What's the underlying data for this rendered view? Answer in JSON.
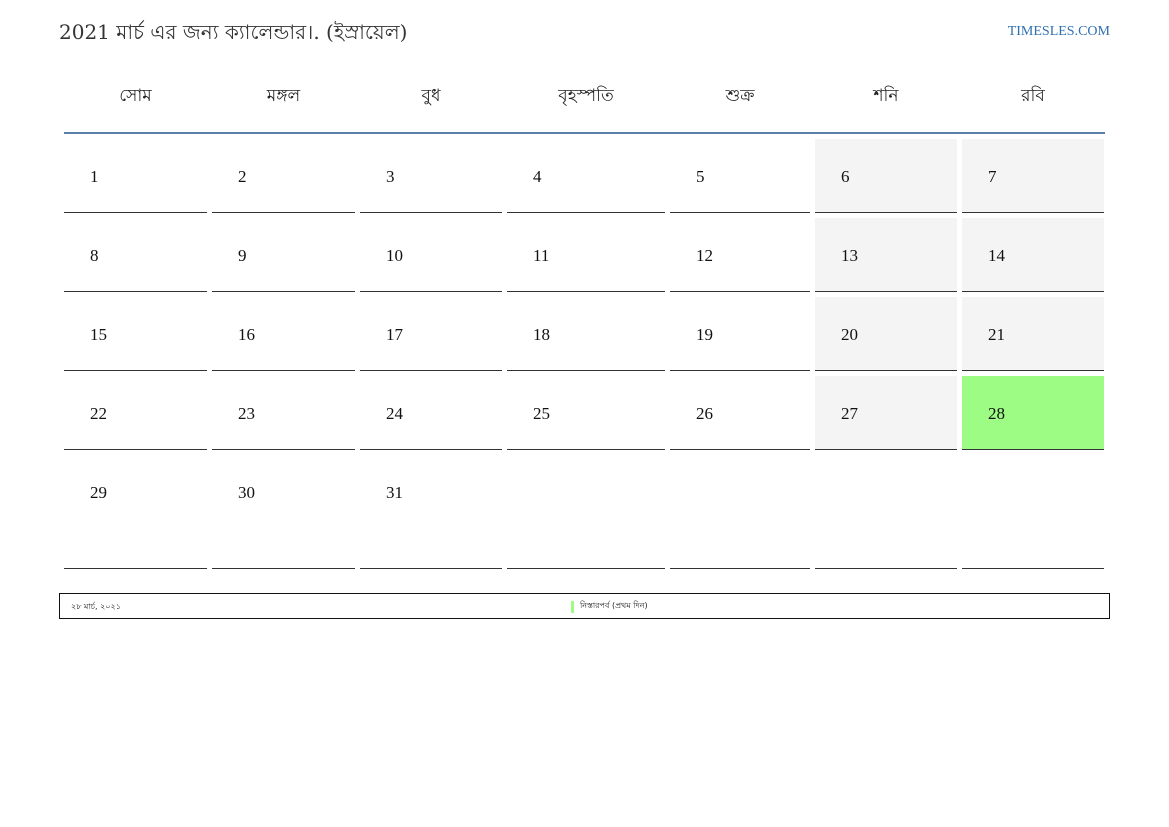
{
  "header": {
    "title": "2021 মার্চ এর জন্য ক্যালেন্ডার।. (ইস্রায়েল)",
    "brand": "TIMESLES.COM"
  },
  "calendar": {
    "weekdays": [
      "সোম",
      "মঙ্গল",
      "বুধ",
      "বৃহস্পতি",
      "শুক্র",
      "শনি",
      "রবি"
    ],
    "weeks": [
      [
        "1",
        "2",
        "3",
        "4",
        "5",
        "6",
        "7"
      ],
      [
        "8",
        "9",
        "10",
        "11",
        "12",
        "13",
        "14"
      ],
      [
        "15",
        "16",
        "17",
        "18",
        "19",
        "20",
        "21"
      ],
      [
        "22",
        "23",
        "24",
        "25",
        "26",
        "27",
        "28"
      ],
      [
        "29",
        "30",
        "31",
        "",
        "",
        "",
        ""
      ]
    ],
    "highlighted_day": "28"
  },
  "legend": {
    "date": "২৮ মার্চ, ২০২১",
    "holiday": "নিস্তারপর্ব (প্রথম দিন)"
  },
  "colors": {
    "accent": "#5a7fa8",
    "brand": "#2f6fb0",
    "weekend": "#f4f4f4",
    "holiday": "#9cfc84"
  }
}
